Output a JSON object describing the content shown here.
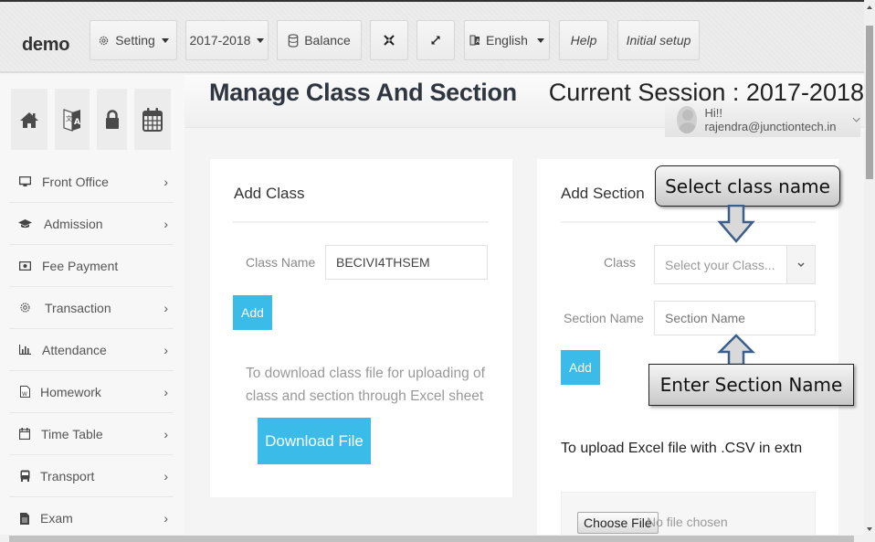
{
  "app": {
    "brand": "demo"
  },
  "toolbar": {
    "setting_label": "Setting",
    "session_label": "2017-2018",
    "balance_label": "Balance",
    "language_label": "English",
    "help_label": "Help",
    "initial_setup_label": "Initial setup",
    "icons": {
      "setting": "gear-icon",
      "balance": "database-icon",
      "compress": "compress-icon",
      "expand": "expand-icon",
      "language": "translate-icon"
    }
  },
  "quick_links": [
    {
      "icon": "home-icon"
    },
    {
      "icon": "translate-icon"
    },
    {
      "icon": "lock-icon"
    },
    {
      "icon": "calendar-icon"
    }
  ],
  "sidebar": {
    "items": [
      {
        "label": "Front Office",
        "icon": "monitor-icon",
        "has_children": true
      },
      {
        "label": "Admission",
        "icon": "graduation-cap-icon",
        "has_children": true
      },
      {
        "label": "Fee Payment",
        "icon": "money-icon",
        "has_children": false
      },
      {
        "label": "Transaction",
        "icon": "gear-icon",
        "has_children": true
      },
      {
        "label": "Attendance",
        "icon": "bar-chart-icon",
        "has_children": true
      },
      {
        "label": "Homework",
        "icon": "word-file-icon",
        "has_children": true
      },
      {
        "label": "Time Table",
        "icon": "calendar-icon",
        "has_children": true
      },
      {
        "label": "Transport",
        "icon": "bus-icon",
        "has_children": true
      },
      {
        "label": "Exam",
        "icon": "file-icon",
        "has_children": true
      }
    ]
  },
  "header": {
    "title": "Manage Class And Section",
    "session_text": "Current Session : 2017-2018",
    "user_greeting": "Hi!! rajendra@junctiontech.in"
  },
  "add_class": {
    "title": "Add Class",
    "class_name_label": "Class Name",
    "class_name_value": "BECIVI4THSEM",
    "add_label": "Add",
    "help_text_line1": "To download class file for uploading of",
    "help_text_line2": "class and section through Excel sheet",
    "download_label": "Download File"
  },
  "add_section": {
    "title": "Add Section",
    "class_label": "Class",
    "class_placeholder": "Select your Class...",
    "section_name_label": "Section Name",
    "section_name_placeholder": "Section Name",
    "add_label": "Add",
    "upload_text": "To upload Excel file with .CSV in extn",
    "choose_file_label": "Choose File",
    "no_file_text": "No file chosen"
  },
  "annotations": {
    "select_class": "Select class name",
    "enter_section": "Enter Section Name"
  },
  "colors": {
    "primary_button": "#3bbbe8",
    "title_text": "#2f3640"
  }
}
